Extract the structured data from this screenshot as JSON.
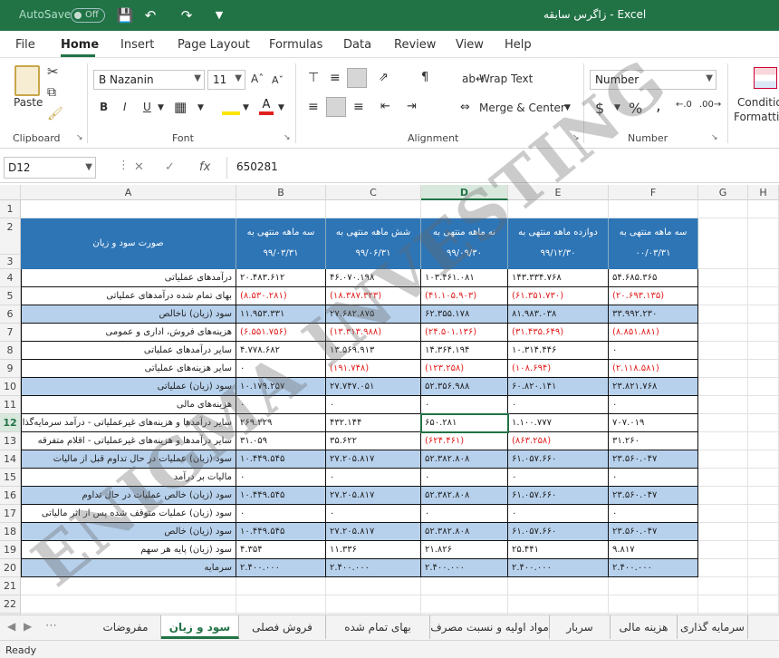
{
  "titlebar": {
    "autosave": "AutoSave",
    "toggle": "Off",
    "title": "زاگرس سابقه  -  Excel"
  },
  "menu": {
    "file": "File",
    "home": "Home",
    "insert": "Insert",
    "page_layout": "Page Layout",
    "formulas": "Formulas",
    "data": "Data",
    "review": "Review",
    "view": "View",
    "help": "Help"
  },
  "ribbon": {
    "paste": "Paste",
    "clipboard": "Clipboard",
    "font_name": "B Nazanin",
    "font_size": "11",
    "font": "Font",
    "wrap": "Wrap Text",
    "merge": "Merge & Center",
    "alignment": "Alignment",
    "num_format": "Number",
    "number": "Number",
    "cond1": "Conditio",
    "cond2": "Formattin",
    "bold": "B",
    "italic": "I",
    "underline": "U",
    "currency": "$",
    "percent": "%",
    "comma": ","
  },
  "formula_bar": {
    "name_box": "D12",
    "value": "650281"
  },
  "columns": [
    "A",
    "B",
    "C",
    "D",
    "E",
    "F",
    "G",
    "H"
  ],
  "table": {
    "title": "صورت سود و زیان",
    "headers": [
      {
        "line1": "سه ماهه منتهی به",
        "line2": "۹۹/۰۳/۳۱"
      },
      {
        "line1": "شش ماهه منتهی به",
        "line2": "۹۹/۰۶/۳۱"
      },
      {
        "line1": "نه ماهه منتهی به",
        "line2": "۹۹/۰۹/۳۰"
      },
      {
        "line1": "دوازده ماهه منتهی به",
        "line2": "۹۹/۱۲/۳۰"
      },
      {
        "line1": "سه ماهه منتهی به",
        "line2": "۰۰/۰۳/۳۱"
      }
    ],
    "rows": [
      {
        "n": "4",
        "label": "درآمدهای عملیاتی",
        "values": [
          "۲۰.۴۸۳.۶۱۲",
          "۴۶.۰۷۰.۱۹۸",
          "۱۰۳.۴۶۱.۰۸۱",
          "۱۴۳.۳۳۴.۷۶۸",
          "۵۴.۶۸۵.۳۶۵"
        ],
        "neg": [
          false,
          false,
          false,
          false,
          false
        ],
        "blue": false
      },
      {
        "n": "5",
        "label": "بهای تمام شده درآمدهای عملیاتی",
        "values": [
          "(۸.۵۳۰.۲۸۱)",
          "(۱۸.۳۸۷.۳۲۳)",
          "(۴۱.۱۰۵.۹۰۳)",
          "(۶۱.۳۵۱.۷۳۰)",
          "(۲۰.۶۹۳.۱۳۵)"
        ],
        "neg": [
          true,
          true,
          true,
          true,
          true
        ],
        "blue": false
      },
      {
        "n": "6",
        "label": "سود (زیان) ناخالص",
        "values": [
          "۱۱.۹۵۳.۳۳۱",
          "۲۷.۶۸۲.۸۷۵",
          "۶۲.۳۵۵.۱۷۸",
          "۸۱.۹۸۳.۰۳۸",
          "۳۳.۹۹۲.۲۳۰"
        ],
        "neg": [
          false,
          false,
          false,
          false,
          false
        ],
        "blue": true
      },
      {
        "n": "7",
        "label": "هزینه‌های فروش، اداری و عمومی",
        "values": [
          "(۶.۵۵۱.۷۵۶)",
          "(۱۳.۳۱۳.۹۸۸)",
          "(۲۴.۵۰۱.۱۳۶)",
          "(۳۱.۴۳۵.۶۴۹)",
          "(۸.۸۵۱.۸۸۱)"
        ],
        "neg": [
          true,
          true,
          true,
          true,
          true
        ],
        "blue": false
      },
      {
        "n": "8",
        "label": "سایر درآمدهای عملیاتی",
        "values": [
          "۴.۷۷۸.۶۸۲",
          "۱۳.۵۶۹.۹۱۳",
          "۱۴.۳۶۴.۱۹۴",
          "۱۰.۳۱۴.۴۴۶",
          "۰"
        ],
        "neg": [
          false,
          false,
          false,
          false,
          false
        ],
        "blue": false
      },
      {
        "n": "9",
        "label": "سایر هزینه‌های عملیاتی",
        "values": [
          "۰",
          "(۱۹۱.۷۴۸)",
          "(۱۲۳.۲۵۸)",
          "(۱۰۸.۶۹۴)",
          "(۲.۱۱۸.۵۸۱)"
        ],
        "neg": [
          false,
          true,
          true,
          true,
          true
        ],
        "blue": false
      },
      {
        "n": "10",
        "label": "سود (زیان) عملیاتی",
        "values": [
          "۱۰.۱۷۹.۲۵۷",
          "۲۷.۷۴۷.۰۵۱",
          "۵۲.۳۵۶.۹۸۸",
          "۶۰.۸۲۰.۱۴۱",
          "۲۳.۸۲۱.۷۶۸"
        ],
        "neg": [
          false,
          false,
          false,
          false,
          false
        ],
        "blue": true
      },
      {
        "n": "11",
        "label": "هزینه‌های مالی",
        "values": [
          "۰",
          "۰",
          "۰",
          "۰",
          "۰"
        ],
        "neg": [
          false,
          false,
          false,
          false,
          false
        ],
        "blue": false
      },
      {
        "n": "12",
        "label": "سایر درآمدها و هزینه‌های غیرعملیاتی - درآمد سرمایه‌گذاری‌ها",
        "values": [
          "۲۶۹.۲۲۹",
          "۴۳۲.۱۴۴",
          "۶۵۰.۲۸۱",
          "۱.۱۰۰.۷۷۷",
          "۷۰۷.۰۱۹"
        ],
        "neg": [
          false,
          false,
          false,
          false,
          false
        ],
        "blue": false
      },
      {
        "n": "13",
        "label": "سایر درآمدها و هزینه‌های غیرعملیاتی - اقلام متفرقه",
        "values": [
          "۳۱.۰۵۹",
          "۳۵.۶۲۲",
          "(۶۲۴.۴۶۱)",
          "(۸۶۳.۲۵۸)",
          "۳۱.۲۶۰"
        ],
        "neg": [
          false,
          false,
          true,
          true,
          false
        ],
        "blue": false
      },
      {
        "n": "14",
        "label": "سود (زیان) عملیات در حال تداوم قبل از مالیات",
        "values": [
          "۱۰.۴۴۹.۵۴۵",
          "۲۷.۲۰۵.۸۱۷",
          "۵۲.۳۸۲.۸۰۸",
          "۶۱.۰۵۷.۶۶۰",
          "۲۳.۵۶۰.۰۴۷"
        ],
        "neg": [
          false,
          false,
          false,
          false,
          false
        ],
        "blue": true
      },
      {
        "n": "15",
        "label": "مالیات بر درآمد",
        "values": [
          "۰",
          "۰",
          "۰",
          "۰",
          "۰"
        ],
        "neg": [
          false,
          false,
          false,
          false,
          false
        ],
        "blue": false
      },
      {
        "n": "16",
        "label": "سود (زیان) خالص عملیات در حال تداوم",
        "values": [
          "۱۰.۴۴۹.۵۴۵",
          "۲۷.۲۰۵.۸۱۷",
          "۵۲.۳۸۲.۸۰۸",
          "۶۱.۰۵۷.۶۶۰",
          "۲۳.۵۶۰.۰۴۷"
        ],
        "neg": [
          false,
          false,
          false,
          false,
          false
        ],
        "blue": true
      },
      {
        "n": "17",
        "label": "سود (زیان) عملیات متوقف شده پس از اثر مالیاتی",
        "values": [
          "۰",
          "۰",
          "۰",
          "۰",
          "۰"
        ],
        "neg": [
          false,
          false,
          false,
          false,
          false
        ],
        "blue": false
      },
      {
        "n": "18",
        "label": "سود (زیان) خالص",
        "values": [
          "۱۰.۴۴۹.۵۴۵",
          "۲۷.۲۰۵.۸۱۷",
          "۵۲.۳۸۲.۸۰۸",
          "۶۱.۰۵۷.۶۶۰",
          "۲۳.۵۶۰.۰۴۷"
        ],
        "neg": [
          false,
          false,
          false,
          false,
          false
        ],
        "blue": true
      },
      {
        "n": "19",
        "label": "سود (زیان) پایه هر سهم",
        "values": [
          "۴.۳۵۴",
          "۱۱.۳۳۶",
          "۲۱.۸۲۶",
          "۲۵.۴۴۱",
          "۹.۸۱۷"
        ],
        "neg": [
          false,
          false,
          false,
          false,
          false
        ],
        "blue": false
      },
      {
        "n": "20",
        "label": "سرمایه",
        "values": [
          "۲.۴۰۰.۰۰۰",
          "۲.۴۰۰.۰۰۰",
          "۲.۴۰۰.۰۰۰",
          "۲.۴۰۰.۰۰۰",
          "۲.۴۰۰.۰۰۰"
        ],
        "neg": [
          false,
          false,
          false,
          false,
          false
        ],
        "blue": true
      }
    ]
  },
  "sheet_tabs": [
    "مفروضات",
    "سود و زیان",
    "فروش فصلی",
    "بهای تمام شده",
    "مواد اولیه و نسبت مصرف",
    "سربار",
    "هزینه مالی",
    "سرمایه گذاری"
  ],
  "active_tab": 1,
  "status": "Ready",
  "watermark": "ENIGMA INVESTING",
  "colors": {
    "excel_green": "#217346",
    "header_blue": "#2e75b6",
    "band_blue": "#b7d1ec",
    "negative": "#e0201e"
  }
}
